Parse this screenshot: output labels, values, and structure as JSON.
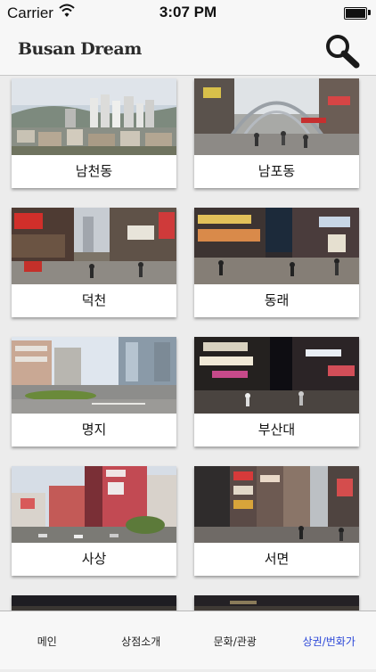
{
  "status_bar": {
    "carrier": "Carrier",
    "time": "3:07 PM",
    "battery_level": 1.0
  },
  "header": {
    "title": "Busan Dream",
    "search_icon": "magnifier"
  },
  "districts": [
    {
      "label": "남천동",
      "photo": "city-skyline-icon"
    },
    {
      "label": "남포동",
      "photo": "market-arch-street-icon"
    },
    {
      "label": "덕천",
      "photo": "shopping-street-icon"
    },
    {
      "label": "동래",
      "photo": "night-street-icon"
    },
    {
      "label": "명지",
      "photo": "road-buildings-icon"
    },
    {
      "label": "부산대",
      "photo": "neon-alley-icon"
    },
    {
      "label": "사상",
      "photo": "department-store-icon"
    },
    {
      "label": "서면",
      "photo": "signboard-street-icon"
    }
  ],
  "tabs": [
    {
      "label": "메인",
      "active": false
    },
    {
      "label": "상점소개",
      "active": false
    },
    {
      "label": "문화/관광",
      "active": false
    },
    {
      "label": "상권/번화가",
      "active": true
    }
  ],
  "colors": {
    "active_tab": "#2c48d8",
    "bar_background": "#f7f7f7",
    "page_background": "#ececec"
  }
}
